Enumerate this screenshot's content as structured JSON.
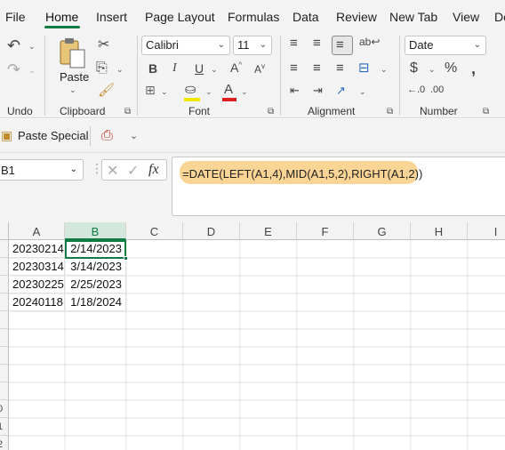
{
  "tabs": [
    "File",
    "Home",
    "Insert",
    "Page Layout",
    "Formulas",
    "Data",
    "Review",
    "New Tab",
    "View",
    "De"
  ],
  "ribbon": {
    "groups": {
      "undo": "Undo",
      "clipboard": "Clipboard",
      "font": "Font",
      "alignment": "Alignment",
      "number": "Number"
    },
    "paste_label": "Paste",
    "font_name": "Calibri",
    "font_size": "11",
    "number_format": "Date",
    "bold": "B",
    "italic": "I",
    "underline": "U"
  },
  "qat": {
    "paste_special": "Paste Special"
  },
  "formula_bar": {
    "name_box": "B1",
    "formula": "=DATE(LEFT(A1,4),MID(A1,5,2),RIGHT(A1,2))"
  },
  "columns": [
    "A",
    "B",
    "C",
    "D",
    "E",
    "F",
    "G",
    "H",
    "I"
  ],
  "rows": [
    [
      "20230214",
      "2/14/2023"
    ],
    [
      "20230314",
      "3/14/2023"
    ],
    [
      "20230225",
      "2/25/2023"
    ],
    [
      "20240118",
      "1/18/2024"
    ]
  ],
  "row_numbers_visible": [
    "0",
    "1",
    "2"
  ],
  "colors": {
    "accent": "#107c41",
    "highlight": "#fbd08a"
  }
}
